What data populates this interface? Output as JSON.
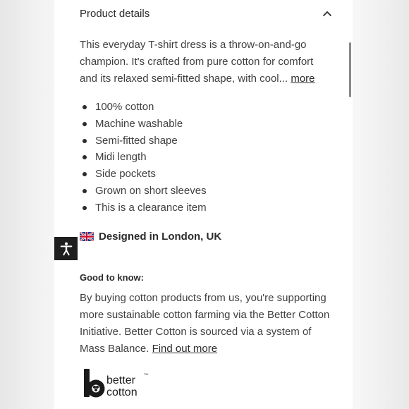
{
  "section": {
    "title": "Product details",
    "description": "This everyday T-shirt dress is a throw-on-and-go champion. It's crafted from pure cotton for comfort and its relaxed semi-fitted shape, with cool...",
    "more_link": "more"
  },
  "features": [
    "100% cotton",
    "Machine washable",
    "Semi-fitted shape",
    "Midi length",
    "Side pockets",
    "Grown on short sleeves",
    "This is a clearance item"
  ],
  "origin": {
    "flag_icon": "uk-flag-icon",
    "label": "Designed in London, UK"
  },
  "good_to_know": {
    "heading": "Good to know:",
    "text": "By buying cotton products from us, you're supporting more sustainable cotton farming via the Better Cotton Initiative. Better Cotton is sourced via a system of Mass Balance.",
    "link": "Find out more"
  },
  "logo": {
    "line1": "better",
    "line2": "cotton",
    "tm": "TM"
  },
  "accessibility": {
    "icon": "accessibility-icon"
  },
  "colors": {
    "text": "#3f3f3f",
    "heading": "#2b2b2b",
    "panel": "#ffffff",
    "access_button": "#1e1e1e"
  }
}
